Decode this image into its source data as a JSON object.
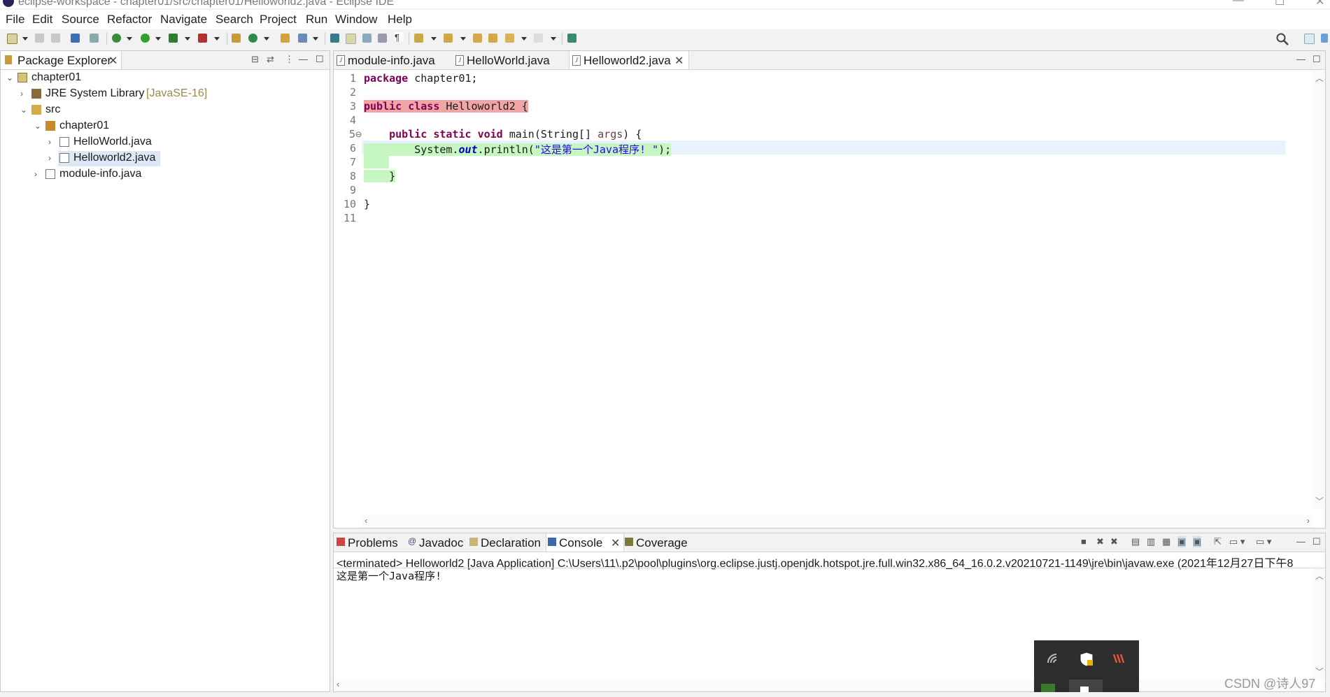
{
  "window": {
    "title": "eclipse-workspace - chapter01/src/chapter01/Helloworld2.java - Eclipse IDE",
    "minimize_glyph": "—",
    "maximize_glyph": "☐",
    "close_glyph": "✕"
  },
  "menu": [
    "File",
    "Edit",
    "Source",
    "Refactor",
    "Navigate",
    "Search",
    "Project",
    "Run",
    "Window",
    "Help"
  ],
  "package_explorer": {
    "tab_label": "Package Explorer",
    "tree": [
      {
        "label": "chapter01",
        "level": 0,
        "expanded": true,
        "icon": "project-icon"
      },
      {
        "label": "JRE System Library",
        "suffix": "[JavaSE-16]",
        "level": 1,
        "expanded": false,
        "icon": "library-icon"
      },
      {
        "label": "src",
        "level": 1,
        "expanded": true,
        "icon": "source-folder-icon"
      },
      {
        "label": "chapter01",
        "level": 2,
        "expanded": true,
        "icon": "package-icon"
      },
      {
        "label": "HelloWorld.java",
        "level": 3,
        "expanded": false,
        "icon": "java-file-icon"
      },
      {
        "label": "Helloworld2.java",
        "level": 3,
        "expanded": false,
        "icon": "java-file-icon",
        "selected": true
      },
      {
        "label": "module-info.java",
        "level": 2,
        "expanded": false,
        "icon": "java-file-icon"
      }
    ]
  },
  "editor": {
    "tabs": [
      {
        "label": "module-info.java",
        "active": false
      },
      {
        "label": "HelloWorld.java",
        "active": false
      },
      {
        "label": "Helloworld2.java",
        "active": true
      }
    ],
    "line_numbers": [
      "1",
      "2",
      "3",
      "4",
      "5⊖",
      "6",
      "7",
      "8",
      "9",
      "10",
      "11"
    ],
    "code": {
      "l1_kw": "package",
      "l1_rest": " chapter01;",
      "l3_kw1": "public",
      "l3_kw2": "class",
      "l3_rest": " Helloworld2 {",
      "l5_indent": "    ",
      "l5_kw1": "public",
      "l5_kw2": "static",
      "l5_kw3": "void",
      "l5_mid": " main(String[] ",
      "l5_param": "args",
      "l5_end": ") {",
      "l6_pre": "        System.",
      "l6_field": "out",
      "l6_mid": ".println(",
      "l6_str": "\"这是第一个Java程序! \"",
      "l6_end": ");",
      "l8_text": "    }",
      "l10_text": "}"
    }
  },
  "console": {
    "tabs": [
      {
        "label": "Problems",
        "icon": "problems-icon",
        "active": false
      },
      {
        "label": "Javadoc",
        "icon": "javadoc-icon",
        "active": false
      },
      {
        "label": "Declaration",
        "icon": "declaration-icon",
        "active": false
      },
      {
        "label": "Console",
        "icon": "console-icon",
        "active": true
      },
      {
        "label": "Coverage",
        "icon": "coverage-icon",
        "active": false
      }
    ],
    "terminated_line": "<terminated> Helloworld2 [Java Application] C:\\Users\\11\\.p2\\pool\\plugins\\org.eclipse.justj.openjdk.hotspot.jre.full.win32.x86_64_16.0.2.v20210721-1149\\jre\\bin\\javaw.exe  (2021年12月27日下午8",
    "output": "这是第一个Java程序!"
  },
  "watermark": "CSDN @诗人97",
  "colors": {
    "keyword": "#7f0055",
    "string": "#2a00ff",
    "field": "#0000c0",
    "error_highlight": "#f2a5a5",
    "diff_highlight": "#c7f7c0"
  }
}
